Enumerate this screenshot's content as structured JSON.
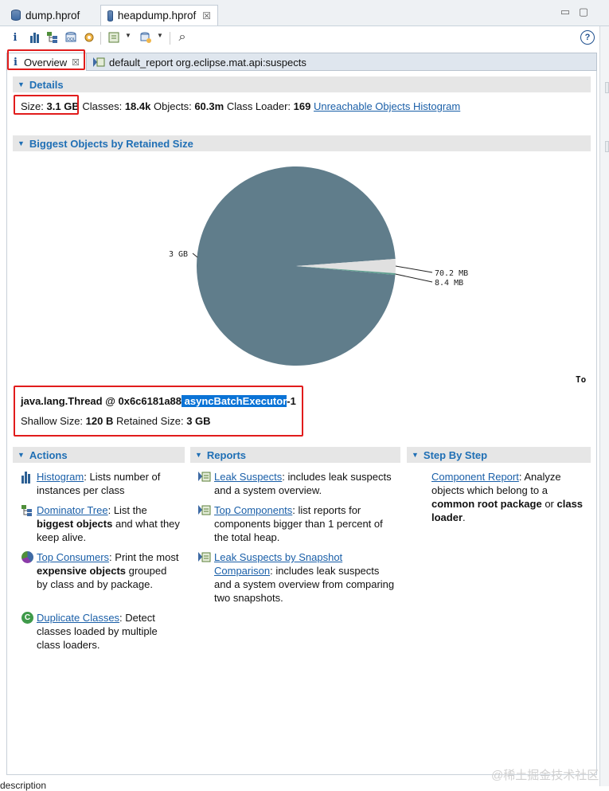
{
  "editor_tabs": [
    {
      "label": "dump.hprof"
    },
    {
      "label": "heapdump.hprof",
      "close": "☒"
    }
  ],
  "inner_tabs": {
    "overview": {
      "label": "Overview",
      "close": "☒"
    },
    "report": {
      "label": "default_report  org.eclipse.mat.api:suspects"
    }
  },
  "details": {
    "header": "Details",
    "size_label": "Size:",
    "size_value": "3.1 GB",
    "classes_label": "Classes:",
    "classes_value": "18.4k",
    "objects_label": "Objects:",
    "objects_value": "60.3m",
    "loader_label": "Class Loader:",
    "loader_value": "169",
    "histogram_link": "Unreachable Objects Histogram"
  },
  "biggest": {
    "header": "Biggest Objects by Retained Size",
    "truncated_label": "To"
  },
  "chart_data": {
    "type": "pie",
    "slices": [
      {
        "label": "3 GB",
        "value": 3000,
        "color": "#607d8b"
      },
      {
        "label": "70.2 MB",
        "value": 70.2,
        "color": "#e0e0e0"
      },
      {
        "label": "8.4 MB",
        "value": 8.4,
        "color": "#5f9e8f"
      }
    ]
  },
  "selected_object": {
    "name_prefix": "java.lang.Thread @ 0x6c6181a88",
    "name_highlight": " asyncBatchExecutor",
    "name_suffix": "-1",
    "shallow_label": "Shallow Size:",
    "shallow_value": "120 B",
    "retained_label": "Retained Size:",
    "retained_value": "3 GB"
  },
  "actions": {
    "header": "Actions",
    "items": [
      {
        "link": "Histogram",
        "text": ": Lists number of instances per class"
      },
      {
        "link": "Dominator Tree",
        "text1": ": List the ",
        "bold1": "biggest objects",
        "text2": " and what they keep alive."
      },
      {
        "link": "Top Consumers",
        "text1": ": Print the most ",
        "bold1": "expensive objects",
        "text2": " grouped by class and by package."
      },
      {
        "link": "Duplicate Classes",
        "text": ": Detect classes loaded by multiple class loaders."
      }
    ]
  },
  "reports": {
    "header": "Reports",
    "items": [
      {
        "link": "Leak Suspects",
        "text": ": includes leak suspects and a system overview."
      },
      {
        "link": "Top Components",
        "text": ": list reports for components bigger than 1 percent of the total heap."
      },
      {
        "link1": "Leak Suspects by Snapshot ",
        "link2": "Comparison",
        "text": ": includes leak suspects and a system overview from comparing two snapshots."
      }
    ]
  },
  "step_by_step": {
    "header": "Step By Step",
    "link": "Component Report",
    "text1": ": Analyze objects which belong to a ",
    "bold1": "common root package",
    "text2": " or ",
    "bold2": "class loader",
    "text3": "."
  },
  "footer": {
    "description": "description",
    "watermark": "@稀土掘金技术社区"
  },
  "toolbar": {
    "info_icon": "i",
    "help_icon": "?",
    "search_icon": "⌕",
    "dropdown": "▼"
  },
  "window": {
    "minimize": "▭",
    "maximize": "▢"
  }
}
